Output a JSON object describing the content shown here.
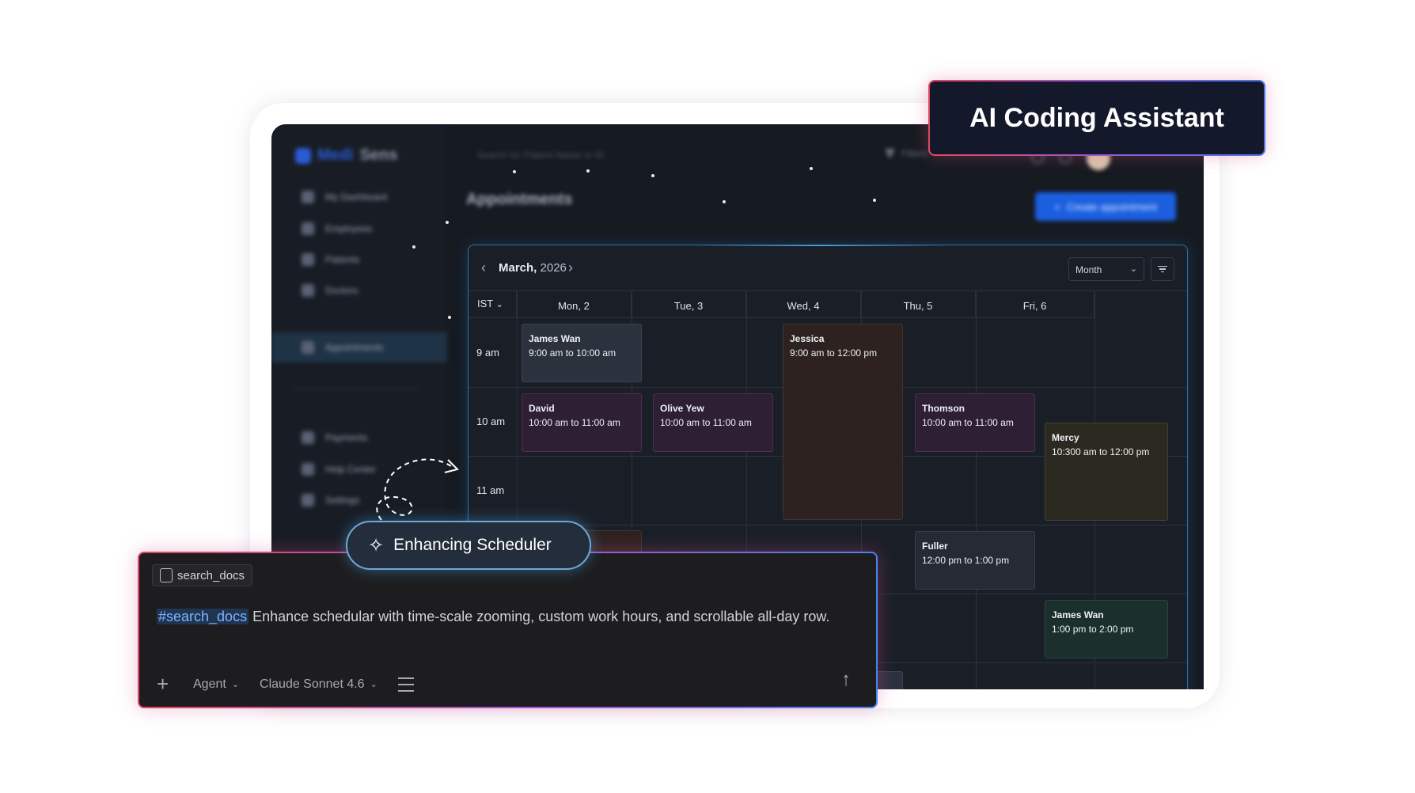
{
  "badge": {
    "title": "AI Coding Assistant"
  },
  "app": {
    "logo": {
      "a": "Medi",
      "b": "Sens"
    },
    "search_placeholder": "Search for Patient Name or ID",
    "filter_label": "Filters",
    "page_title": "Appointments",
    "create_button": "Create appointment",
    "sidebar": {
      "items": [
        {
          "label": "My Dashboard"
        },
        {
          "label": "Employees"
        },
        {
          "label": "Patients"
        },
        {
          "label": "Doctors"
        },
        {
          "label": "Appointments"
        },
        {
          "label": "Payments"
        },
        {
          "label": "Help Center"
        },
        {
          "label": "Settings"
        }
      ]
    }
  },
  "calendar": {
    "month": "March,",
    "year": "2026",
    "view": "Month",
    "timezone": "IST",
    "days": [
      "Mon, 2",
      "Tue, 3",
      "Wed, 4",
      "Thu, 5",
      "Fri, 6"
    ],
    "times": [
      "9 am",
      "10 am",
      "11 am"
    ],
    "events": [
      {
        "name": "James Wan",
        "time": "9:00 am to 10:00 am"
      },
      {
        "name": "Jessica",
        "time": "9:00 am to 12:00 pm"
      },
      {
        "name": "David",
        "time": "10:00 am to 11:00 am"
      },
      {
        "name": "Olive Yew",
        "time": "10:00 am to 11:00 am"
      },
      {
        "name": "Thomson",
        "time": "10:00 am to 11:00 am"
      },
      {
        "name": "Mercy",
        "time": "10:300 am to 12:00 pm"
      },
      {
        "name": "Fuller",
        "time": "12:00 pm to 1:00 pm"
      },
      {
        "name": "James Wan",
        "time": "1:00 pm to 2:00 pm"
      }
    ]
  },
  "status_pill": {
    "label": "Enhancing Scheduler"
  },
  "panel": {
    "tool_chip": "search_docs",
    "tag": "#search_docs",
    "prompt": "Enhance schedular with time-scale zooming, custom work hours, and scrollable all-day row.",
    "mode": "Agent",
    "model": "Claude Sonnet 4.6"
  },
  "colors": {
    "accent_blue": "#1b5fe0",
    "gradient_red": "#e1475d",
    "gradient_purple": "#b04fd0",
    "gradient_blue": "#4b82f0"
  }
}
